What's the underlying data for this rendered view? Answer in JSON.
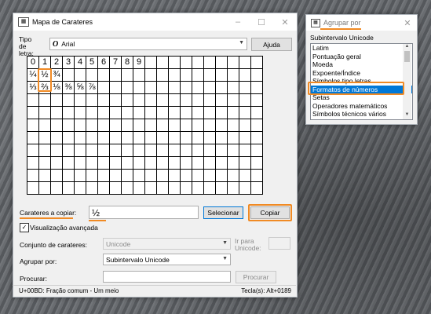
{
  "char_map": {
    "title": "Mapa de Carateres",
    "font_label": "Tipo de letra:",
    "font_value": "Arial",
    "font_icon": "O",
    "help_button": "Ajuda",
    "grid_rows": [
      [
        "0",
        "1",
        "2",
        "3",
        "4",
        "5",
        "6",
        "7",
        "8",
        "9",
        "",
        "",
        "",
        "",
        "",
        "",
        "",
        "",
        "",
        ""
      ],
      [
        "¼",
        "½",
        "¾",
        "",
        "",
        "",
        "",
        "",
        "",
        "",
        "",
        "",
        "",
        "",
        "",
        "",
        "",
        "",
        "",
        ""
      ],
      [
        "⅓",
        "⅔",
        "⅛",
        "⅜",
        "⅝",
        "⅞",
        "",
        "",
        "",
        "",
        "",
        "",
        "",
        "",
        "",
        "",
        "",
        "",
        "",
        ""
      ],
      [
        "",
        "",
        "",
        "",
        "",
        "",
        "",
        "",
        "",
        "",
        "",
        "",
        "",
        "",
        "",
        "",
        "",
        "",
        "",
        ""
      ],
      [
        "",
        "",
        "",
        "",
        "",
        "",
        "",
        "",
        "",
        "",
        "",
        "",
        "",
        "",
        "",
        "",
        "",
        "",
        "",
        ""
      ],
      [
        "",
        "",
        "",
        "",
        "",
        "",
        "",
        "",
        "",
        "",
        "",
        "",
        "",
        "",
        "",
        "",
        "",
        "",
        "",
        ""
      ],
      [
        "",
        "",
        "",
        "",
        "",
        "",
        "",
        "",
        "",
        "",
        "",
        "",
        "",
        "",
        "",
        "",
        "",
        "",
        "",
        ""
      ],
      [
        "",
        "",
        "",
        "",
        "",
        "",
        "",
        "",
        "",
        "",
        "",
        "",
        "",
        "",
        "",
        "",
        "",
        "",
        "",
        ""
      ],
      [
        "",
        "",
        "",
        "",
        "",
        "",
        "",
        "",
        "",
        "",
        "",
        "",
        "",
        "",
        "",
        "",
        "",
        "",
        "",
        ""
      ],
      [
        "",
        "",
        "",
        "",
        "",
        "",
        "",
        "",
        "",
        "",
        "",
        "",
        "",
        "",
        "",
        "",
        "",
        "",
        "",
        ""
      ],
      [
        "",
        "",
        "",
        "",
        "",
        "",
        "",
        "",
        "",
        "",
        "",
        "",
        "",
        "",
        "",
        "",
        "",
        "",
        "",
        ""
      ]
    ],
    "copy_label": "Carateres a copiar:",
    "copy_value": "½",
    "select_button": "Selecionar",
    "copy_button": "Copiar",
    "advanced_label": "Visualização avançada",
    "advanced_checked": "✓",
    "charset_label": "Conjunto de carateres:",
    "charset_value": "Unicode",
    "goto_label": "Ir para Unicode:",
    "group_label": "Agrupar por:",
    "group_value": "Subintervalo Unicode",
    "search_label": "Procurar:",
    "search_value": "",
    "search_button": "Procurar",
    "status_left": "U+00BD: Fração comum - Um meio",
    "status_right": "Tecla(s): Alt+0189"
  },
  "group_popup": {
    "title": "Agrupar por",
    "subtitle": "Subintervalo Unicode",
    "items": [
      "Latim",
      "Pontuação geral",
      "Moeda",
      "Expoente/Índice",
      "Símbolos tipo letras",
      "Formatos de números",
      "Setas",
      "Operadores matemáticos",
      "Símbolos técnicos vários"
    ],
    "selected": "Formatos de números"
  },
  "colors": {
    "highlight": "#f08a24",
    "selection": "#0078d7"
  }
}
